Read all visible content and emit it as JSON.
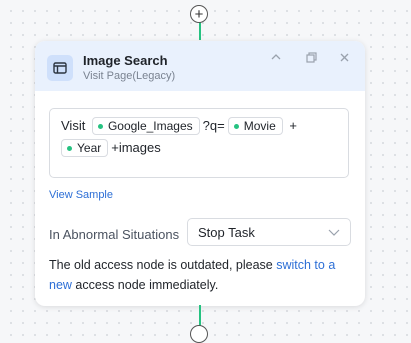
{
  "canvas": {
    "add_node_symbol": "+"
  },
  "node": {
    "title": "Image Search",
    "subtitle": "Visit Page(Legacy)",
    "icon": "browser-window-icon",
    "header_actions": [
      "collapse-icon",
      "copy-icon",
      "close-icon"
    ],
    "url": {
      "line1": {
        "text1": "Visit ",
        "token1": "Google_Images",
        "text2": "?q=",
        "token2": "Movie",
        "text3": " +"
      },
      "line2": {
        "token3": "Year",
        "text4": "+images"
      }
    },
    "view_sample_label": "View Sample",
    "abnormal": {
      "label": "In Abnormal Situations",
      "value": "Stop Task"
    },
    "notice": {
      "before": "The old access node is outdated, please ",
      "link": "switch to a new",
      "after": " access node immediately."
    }
  },
  "colors": {
    "connector": "#26c281",
    "header_bg": "#e9f1fd",
    "link": "#2d6fd6",
    "token_dot": "#26c281"
  }
}
